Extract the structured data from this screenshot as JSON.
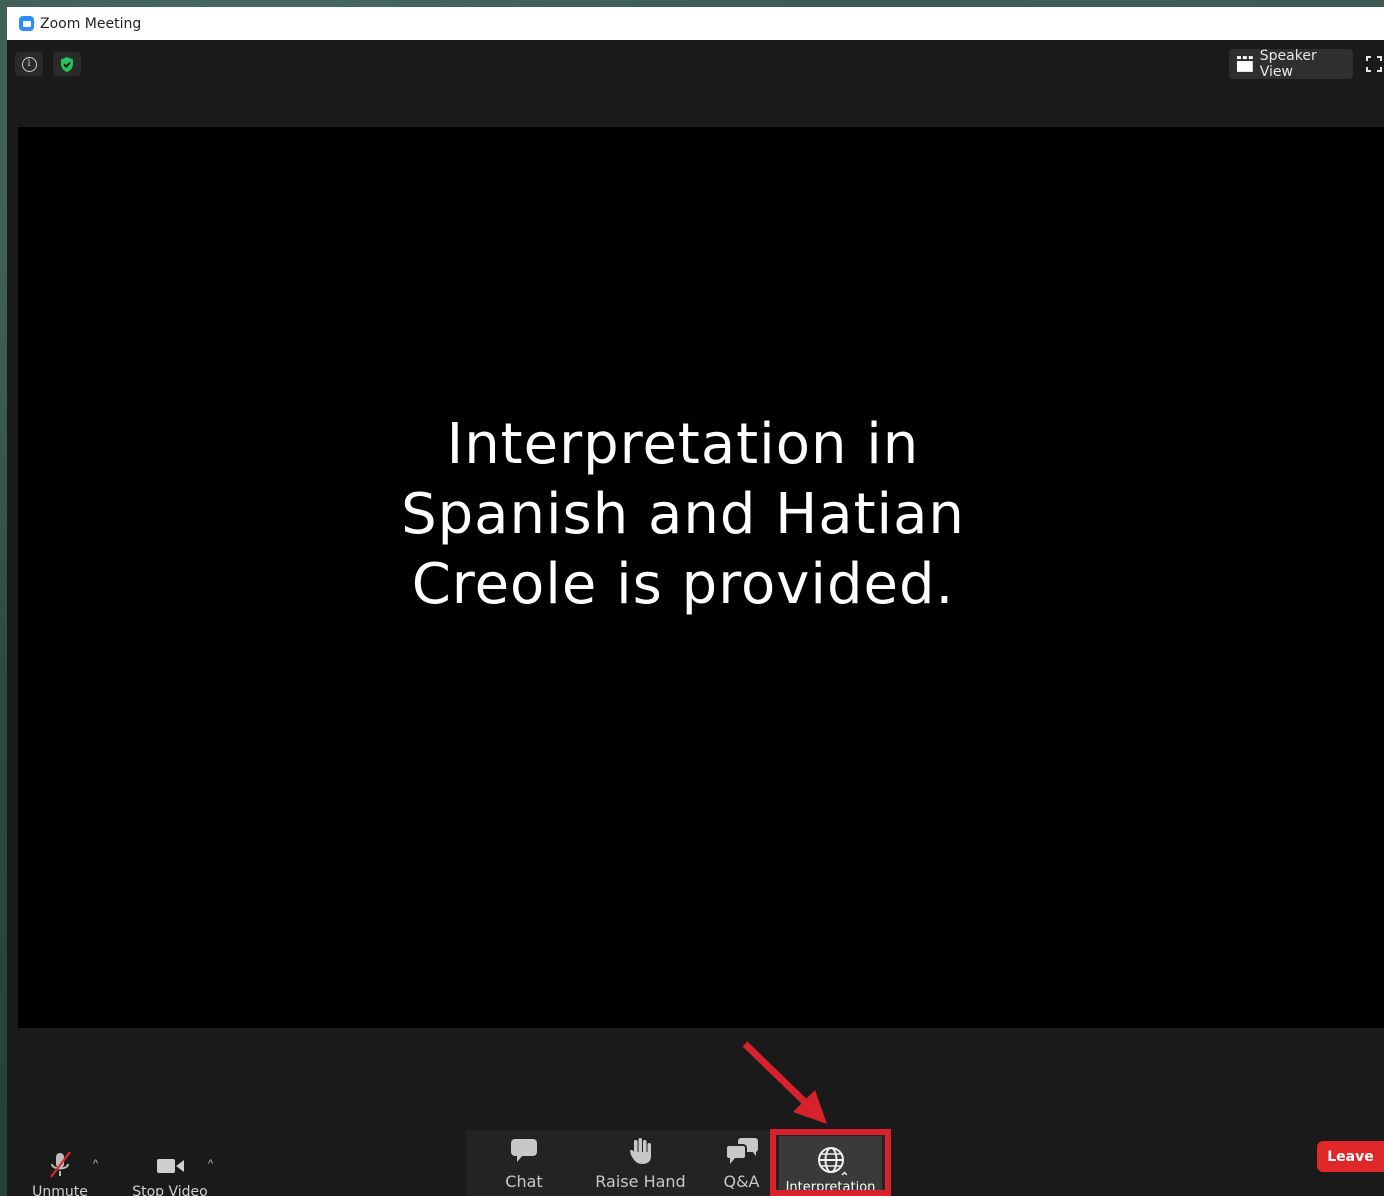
{
  "window": {
    "title": "Zoom Meeting"
  },
  "topbar": {
    "speaker_view_label": "Speaker View"
  },
  "slide": {
    "lines": [
      "Interpretation in",
      "Spanish and Hatian",
      "Creole is provided."
    ]
  },
  "toolbar": {
    "unmute_label": "Unmute",
    "stop_video_label": "Stop Video",
    "chat_label": "Chat",
    "raise_hand_label": "Raise Hand",
    "qa_label": "Q&A",
    "interpretation_label": "Interpretation",
    "leave_label": "Leave"
  },
  "colors": {
    "highlight": "#d7222b",
    "leave": "#e02828",
    "shield": "#22c55e",
    "app_icon": "#2d8cff"
  },
  "icons": [
    "zoom-app-icon",
    "info-icon",
    "shield-icon",
    "grid-icon",
    "fullscreen-icon",
    "muted-mic-icon",
    "video-camera-icon",
    "chat-bubble-icon",
    "raise-hand-icon",
    "qa-bubbles-icon",
    "globe-icon",
    "annotation-arrow"
  ]
}
